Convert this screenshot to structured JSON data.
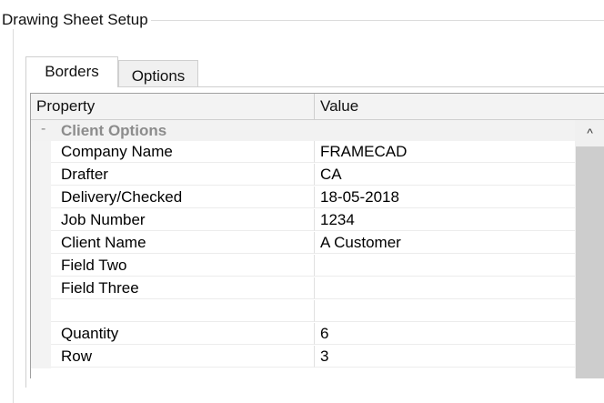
{
  "dialog": {
    "group_title": "Drawing Sheet Setup"
  },
  "tabs": [
    {
      "label": "Borders",
      "active": true
    },
    {
      "label": "Options",
      "active": false
    }
  ],
  "grid": {
    "columns": {
      "property": "Property",
      "value": "Value"
    },
    "category": {
      "toggle": "-",
      "label": "Client Options"
    },
    "rows": [
      {
        "property": "Company Name",
        "value": "FRAMECAD"
      },
      {
        "property": "Drafter",
        "value": "CA"
      },
      {
        "property": "Delivery/Checked",
        "value": "18-05-2018"
      },
      {
        "property": "Job Number",
        "value": "1234"
      },
      {
        "property": "Client Name",
        "value": "A Customer"
      },
      {
        "property": "Field Two",
        "value": ""
      },
      {
        "property": "Field Three",
        "value": ""
      },
      {
        "property": "",
        "value": ""
      },
      {
        "property": "Quantity",
        "value": "6"
      },
      {
        "property": "Row",
        "value": "3"
      }
    ]
  },
  "scrollbar": {
    "up_arrow_glyph": "^",
    "up_arrow_icon": "chevron-up-icon"
  }
}
